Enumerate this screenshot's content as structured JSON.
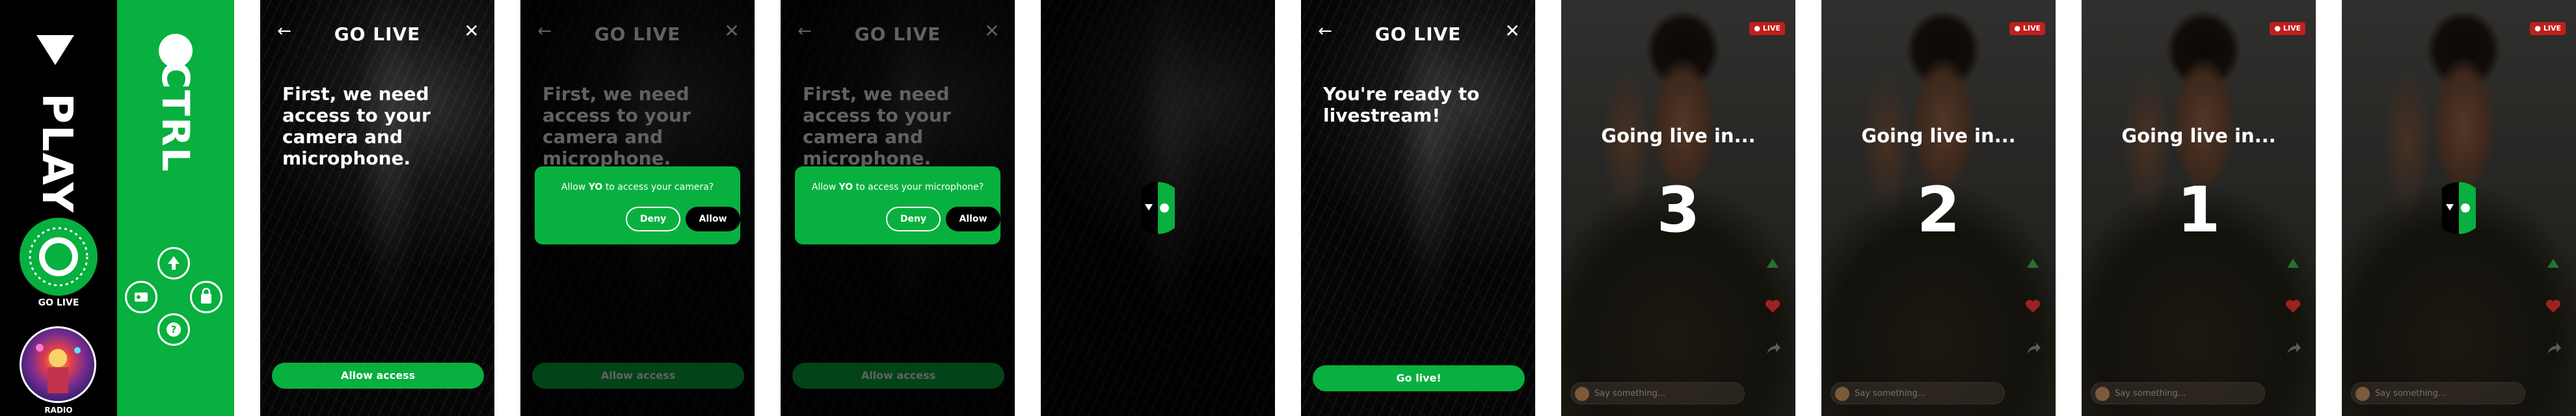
{
  "sidebar": {
    "play_label": "PLAY",
    "go_live_label": "GO LIVE",
    "radio_label": "RADIO"
  },
  "ctrl": {
    "label": "CTRL"
  },
  "golive": {
    "title": "GO LIVE",
    "access_heading": "First, we need access to your camera and microphone.",
    "allow_access_label": "Allow access",
    "camera_dialog": {
      "before": "Allow ",
      "app": "YO",
      "after": " to access your camera?",
      "deny": "Deny",
      "allow": "Allow"
    },
    "mic_dialog": {
      "before": "Allow ",
      "app": "YO",
      "after": " to access your microphone?",
      "deny": "Deny",
      "allow": "Allow"
    },
    "ready_heading": "You're ready to livestream!",
    "go_live_button": "Go live!"
  },
  "countdown": {
    "going_live_label": "Going live in...",
    "live_badge": "LIVE",
    "comment_placeholder": "Say something...",
    "values": [
      "3",
      "2",
      "1"
    ]
  },
  "colors": {
    "accent": "#07b03f",
    "live_red": "#c0201d"
  }
}
